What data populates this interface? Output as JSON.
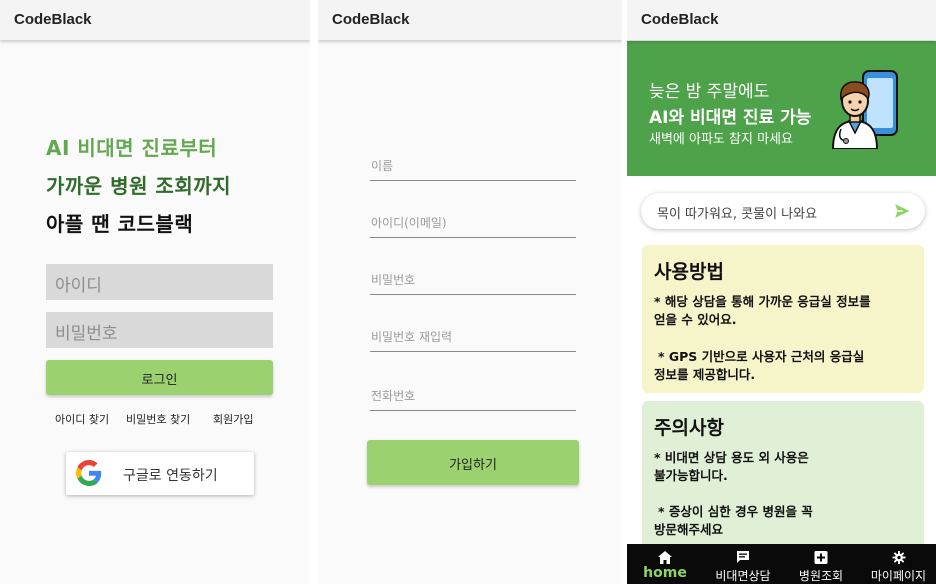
{
  "app_title": "CodeBlack",
  "login": {
    "hero_line1": "AI 비대면 진료부터",
    "hero_line2": "가까운 병원 조회까지",
    "hero_line3": "아플 땐 코드블랙",
    "id_placeholder": "아이디",
    "password_placeholder": "비밀번호",
    "login_button": "로그인",
    "find_id": "아이디 찾기",
    "find_password": "비밀번호 찾기",
    "signup": "회원가입",
    "google_button": "구글로 연동하기",
    "colors": {
      "hero_green": "#62a84e",
      "hero_dark_green": "#2f6b2a",
      "button_green": "#9bd26f"
    }
  },
  "signup_form": {
    "name_placeholder": "이름",
    "email_placeholder": "아이디(이메일)",
    "password_placeholder": "비밀번호",
    "password_confirm_placeholder": "비밀번호 재입력",
    "phone_placeholder": "전화번호",
    "submit_button": "가입하기"
  },
  "home": {
    "banner": {
      "line1": "늦은 밤 주말에도",
      "line2": "AI와 비대면 진료 가능",
      "line3": "새벽에 아파도 참지 마세요",
      "color": "#4ea24a",
      "icon": "doctor-phone-illustration"
    },
    "search_text": "목이 따가워요, 콧물이 나와요",
    "send_icon": "send-icon",
    "usage_card": {
      "title": "사용방법",
      "line1a": "* 해당 상담을 통해 가까운 응급실 정보를",
      "line1b": "얻을 수 있어요.",
      "line2a": "* GPS 기반으로 사용자 근처의 응급실",
      "line2b": "정보를 제공합니다.",
      "color": "#f6f4c9"
    },
    "caution_card": {
      "title": "주의사항",
      "line1a": "* 비대면 상담 용도 외 사용은",
      "line1b": "불가능합니다.",
      "line2a": "* 증상이 심한 경우 병원을 꼭",
      "line2b": "방문해주세요",
      "color": "#dff0d6"
    },
    "nav": [
      {
        "label": "home",
        "icon": "home-icon",
        "active": true
      },
      {
        "label": "비대면상담",
        "icon": "chat-icon",
        "active": false
      },
      {
        "label": "병원조회",
        "icon": "hospital-cross-icon",
        "active": false
      },
      {
        "label": "마이페이지",
        "icon": "gear-icon",
        "active": false
      }
    ]
  }
}
